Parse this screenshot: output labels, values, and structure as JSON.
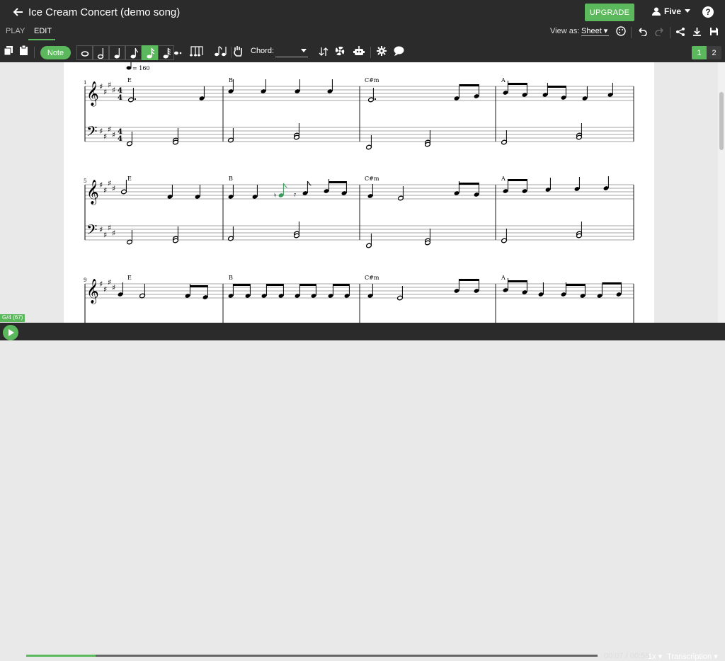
{
  "header": {
    "title": "Ice Cream Concert (demo song)",
    "upgrade_label": "UPGRADE",
    "user_name": "Five",
    "help_label": "?"
  },
  "subbar": {
    "tabs": [
      "PLAY",
      "EDIT"
    ],
    "active_tab": "EDIT",
    "view_as_label": "View as:",
    "view_as_value": "Sheet"
  },
  "toolbar": {
    "note_label": "Note",
    "chord_label": "Chord:",
    "chord_value": "",
    "active_duration": "eighth",
    "pages": [
      "1",
      "2"
    ],
    "active_page": "1"
  },
  "score": {
    "tempo_mark": "= 160",
    "systems": [
      {
        "number": "1",
        "chords": [
          "E",
          "B",
          "C#m",
          "A"
        ],
        "time_signature": "4/4"
      },
      {
        "number": "5",
        "chords": [
          "E",
          "B",
          "C#m",
          "A"
        ]
      },
      {
        "number": "9",
        "chords": [
          "E",
          "B",
          "C#m",
          "A"
        ]
      }
    ],
    "key_signature": "E major (4 sharps)"
  },
  "player": {
    "position_badge": "G/4 (67)",
    "time_display": "00:07 / 00:58",
    "progress": 0.121,
    "speed": "1x",
    "mode": "Transcription"
  },
  "colors": {
    "accent": "#5cb85c",
    "toolbar_bg": "#2b2b2b",
    "canvas_bg": "#e9e9e9",
    "selected_note": "#3a9a5c"
  }
}
